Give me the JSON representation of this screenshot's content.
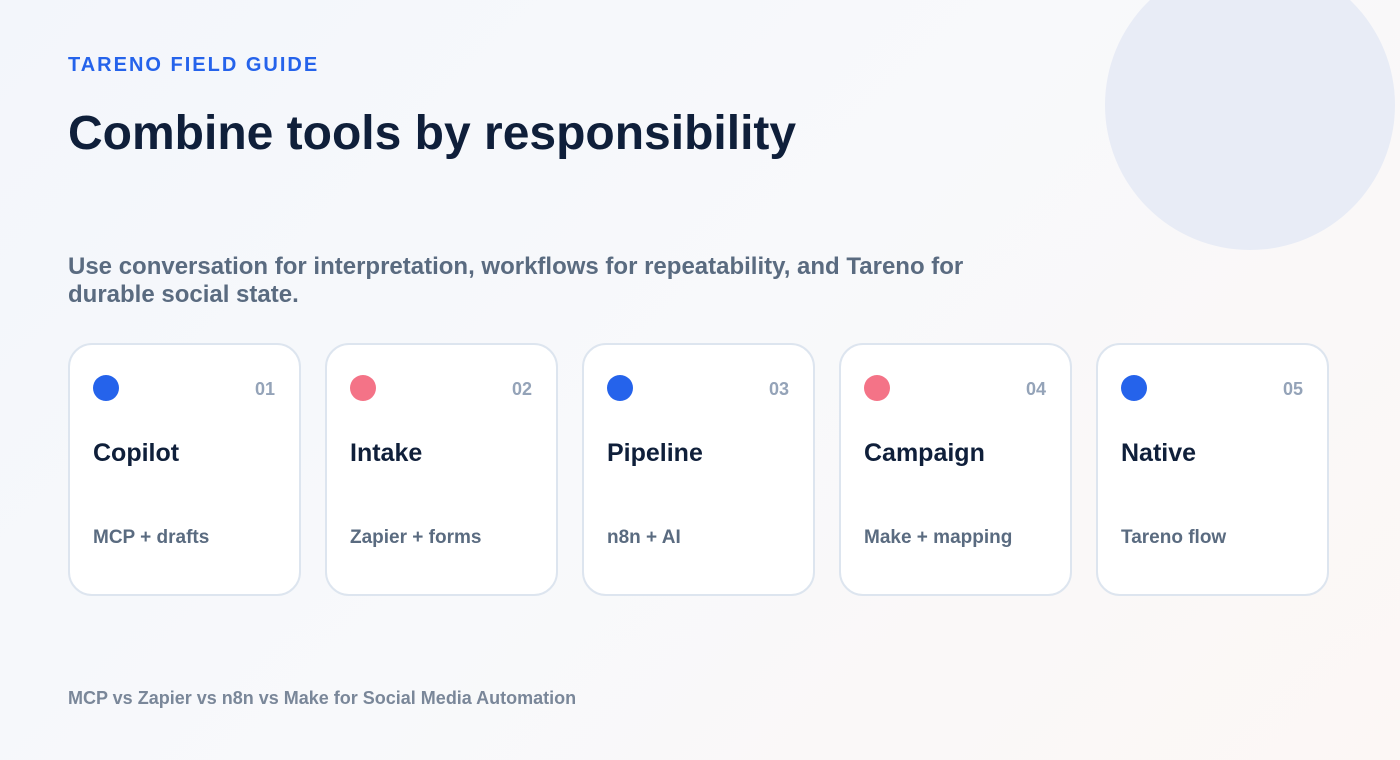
{
  "header": {
    "eyebrow": "TARENO FIELD GUIDE",
    "title": "Combine tools by responsibility",
    "subtitle": "Use conversation for interpretation, workflows for repeatability, and Tareno for durable social state."
  },
  "colors": {
    "accent_blue": "#2563eb",
    "accent_pink": "#f47387",
    "title": "#0f1f3a",
    "muted": "#5a6b80"
  },
  "cards": [
    {
      "number": "01",
      "title": "Copilot",
      "description": "MCP + drafts",
      "dot_color": "#2563eb"
    },
    {
      "number": "02",
      "title": "Intake",
      "description": "Zapier + forms",
      "dot_color": "#f47387"
    },
    {
      "number": "03",
      "title": "Pipeline",
      "description": "n8n + AI",
      "dot_color": "#2563eb"
    },
    {
      "number": "04",
      "title": "Campaign",
      "description": "Make + mapping",
      "dot_color": "#f47387"
    },
    {
      "number": "05",
      "title": "Native",
      "description": "Tareno flow",
      "dot_color": "#2563eb"
    }
  ],
  "footer": {
    "text": "MCP vs Zapier vs n8n vs Make for Social Media Automation"
  }
}
